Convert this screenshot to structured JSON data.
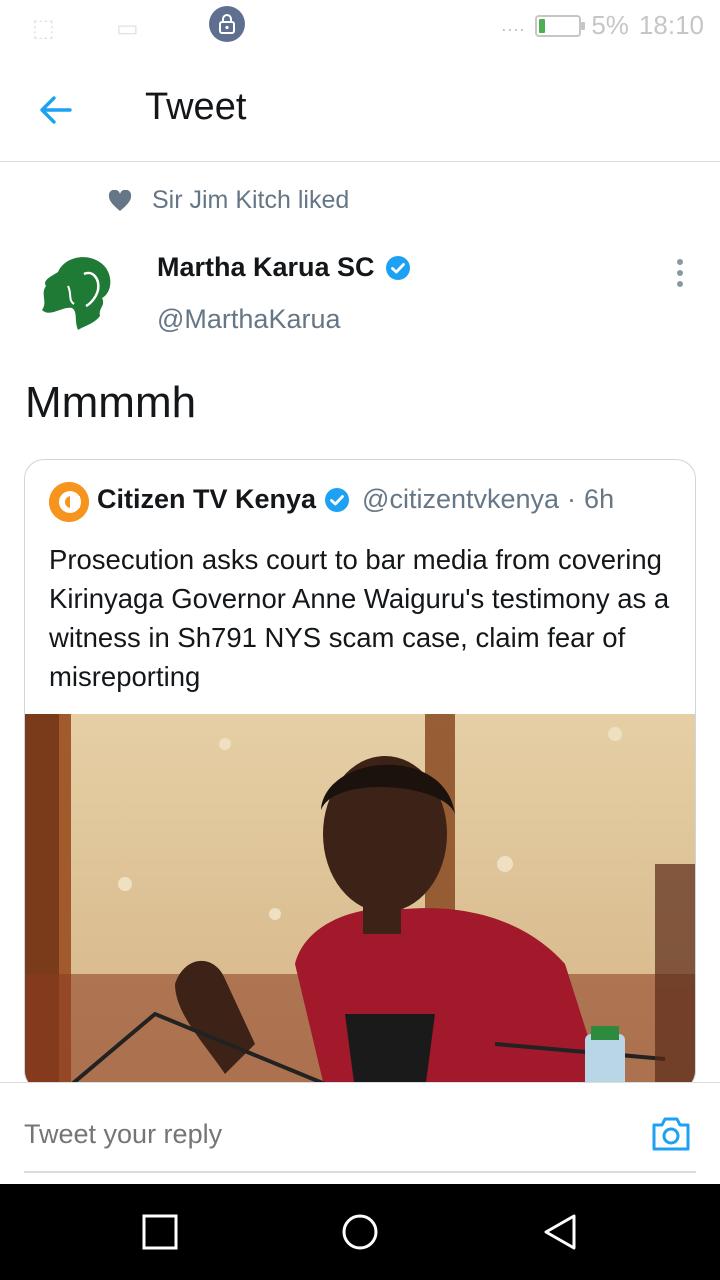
{
  "status_bar": {
    "battery_text": "5%",
    "battery_level": 0.05,
    "time": "18:10",
    "signal_text": "...."
  },
  "app_bar": {
    "title": "Tweet"
  },
  "context": {
    "liked_text": "Sir Jim Kitch liked"
  },
  "tweet": {
    "author_name": "Martha Karua SC",
    "author_handle": "@MarthaKarua",
    "text": "Mmmmh"
  },
  "quoted_tweet": {
    "author_name": "Citizen TV Kenya",
    "author_handle": "@citizentvkenya",
    "separator": "·",
    "time": "6h",
    "text": "Prosecution asks court to bar media from covering Kirinyaga Governor Anne Waiguru's testimony as a witness in Sh791 NYS scam case, claim fear of misreporting"
  },
  "reply": {
    "placeholder": "Tweet your reply"
  },
  "colors": {
    "accent": "#1da1f2",
    "verified": "#1da1f2",
    "brand_green": "#1f7a36",
    "citizen_orange": "#f7941d"
  }
}
